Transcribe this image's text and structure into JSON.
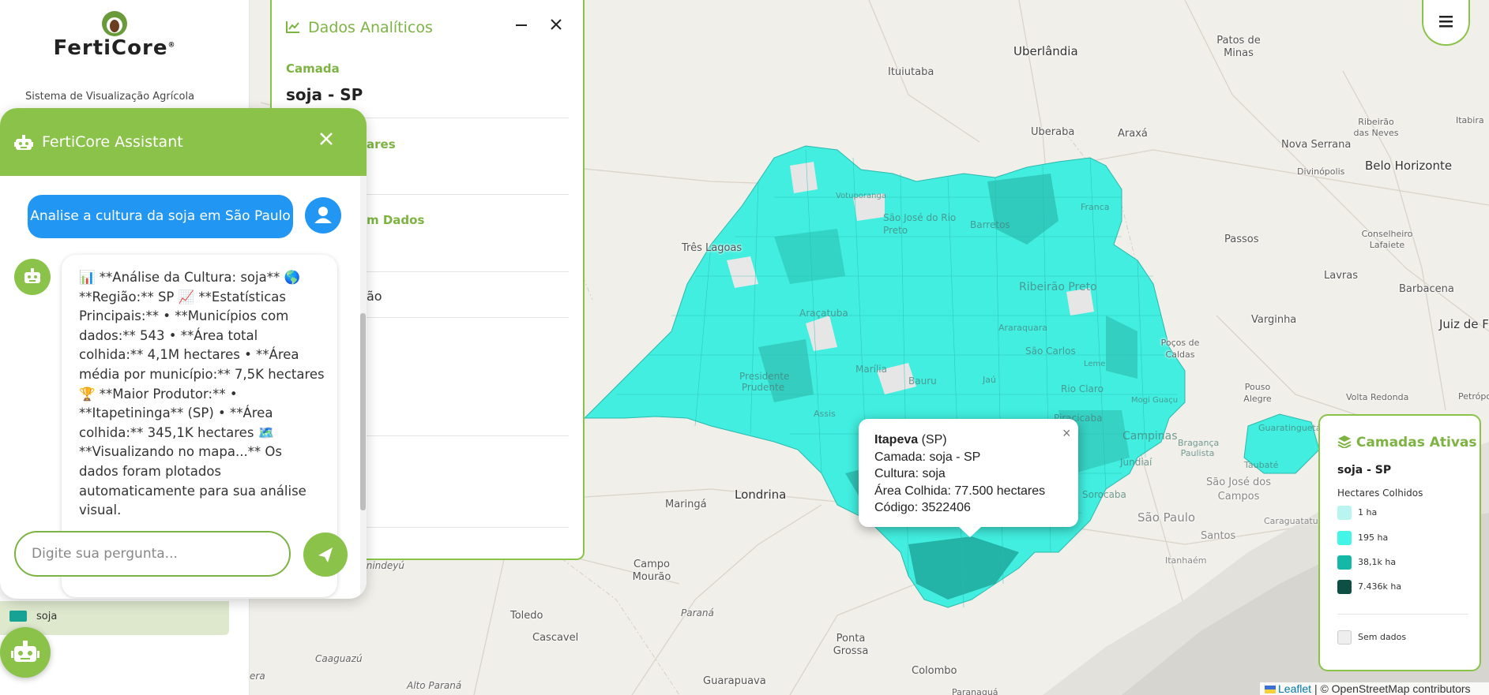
{
  "sidebar": {
    "logo_text": "FertiCore",
    "logo_registered": "®",
    "subtitle": "Sistema de Visualização Agrícola",
    "layer_label": "soja"
  },
  "analytics": {
    "title": "Dados Analíticos",
    "section1_label": "Camada",
    "section1_value": "soja - SP",
    "section2_fragment": "ares",
    "section3_fragment": "m Dados",
    "section4_fragment": "ão",
    "minimize_icon": "minus-icon",
    "close_icon": "close-icon"
  },
  "chat": {
    "title": "FertiCore Assistant",
    "user_message": "Analise a cultura da soja em São Paulo",
    "bot_message": "📊 **Análise da Cultura: soja** 🌎 **Região:** SP 📈 **Estatísticas Principais:** • **Municípios com dados:** 543 • **Área total colhida:** 4,1M hectares • **Área média por município:** 7,5K hectares 🏆 **Maior Produtor:** • **Itapetininga** (SP) • **Área colhida:** 345,1K hectares 🗺️ **Visualizando no mapa...** Os dados foram plotados automaticamente para sua análise visual.",
    "input_placeholder": "Digite sua pergunta...",
    "input_value": ""
  },
  "popup": {
    "municipality": "Itapeva",
    "state": "(SP)",
    "line_camada": "Camada: soja - SP",
    "line_cultura": "Cultura: soja",
    "line_area": "Área Colhida: 77.500 hectares",
    "line_codigo": "Código: 3522406",
    "close": "×"
  },
  "legend": {
    "title": "Camadas Ativas",
    "layer_name": "soja - SP",
    "subtitle": "Hectares Colhidos",
    "items": [
      {
        "label": "1 ha",
        "color": "#b8f5f0"
      },
      {
        "label": "195 ha",
        "color": "#42f5e6"
      },
      {
        "label": "38,1k ha",
        "color": "#14b8a6"
      },
      {
        "label": "7.436k ha",
        "color": "#0d4f45"
      }
    ],
    "no_data_label": "Sem dados",
    "no_data_color": "#eeeeee"
  },
  "attribution": {
    "leaflet": "Leaflet",
    "osm": "| © OpenStreetMap contributors"
  },
  "map": {
    "cities": {
      "uberlandia": "Uberlândia",
      "ituiutaba": "Ituiutaba",
      "uberaba": "Uberaba",
      "araxa": "Araxá",
      "patos": "Patos de Minas",
      "ribeirao_neves": "Ribeirão das Neves",
      "nova_serrana": "Nova Serrana",
      "divinopolis": "Divinópolis",
      "bh": "Belo Horizonte",
      "itabira": "Itabira",
      "tres_lagoas": "Três Lagoas",
      "passos": "Passos",
      "conselheiro": "Conselheiro Lafaiete",
      "lavras": "Lavras",
      "barbacena": "Barbacena",
      "varginha": "Varginha",
      "juiz": "Juiz de Fora",
      "pocos": "Poços de Caldas",
      "pouso": "Pouso Alegre",
      "petropolis": "Petrópolis",
      "volta": "Volta Redonda",
      "sao_jose": "São José dos Campos",
      "sao_paulo": "São Paulo",
      "santos": "Santos",
      "itanhaem": "Itanhaém",
      "caraguatatuba": "Caraguatatuba",
      "londrina": "Londrina",
      "maringa": "Maringá",
      "campo_mourao": "Campo Mourão",
      "toledo": "Toledo",
      "cascavel": "Cascavel",
      "ponta_grossa": "Ponta Grossa",
      "colombo": "Colombo",
      "guarapuava": "Guarapuava",
      "parana": "Paraná",
      "paranagua": "Paranaguá",
      "alto_parana": "Alto Paraná",
      "caaguazu": "Caaguazú",
      "canindeyu": "Canindeyú",
      "era": "era",
      "sjrp": "São José do Rio Preto",
      "votuporanga": "Votuporanga",
      "barretos": "Barretos",
      "franca": "Franca",
      "aracatuba": "Araçatuba",
      "ribeirao": "Ribeirão Preto",
      "araraquara": "Araraquara",
      "sao_carlos": "São Carlos",
      "presidente": "Presidente Prudente",
      "marilia": "Marília",
      "bauru": "Bauru",
      "jau": "Jaú",
      "rio_claro": "Rio Claro",
      "piracicaba": "Piracicaba",
      "campinas": "Campinas",
      "sorocaba": "Sorocaba",
      "assis": "Assis",
      "mogi": "Mogi Guaçu",
      "jundiai": "Jundiaí",
      "braganca": "Bragança Paulista",
      "taubate": "Taubaté",
      "guaratingueta": "Guaratinguetá",
      "leme": "Leme"
    }
  }
}
